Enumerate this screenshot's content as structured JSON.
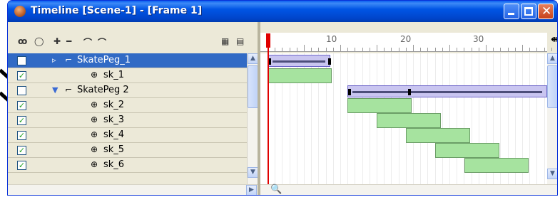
{
  "window": {
    "title": "Timeline [Scene-1] - [Frame 1]",
    "icon": "flash-icon",
    "controls": [
      "minimize",
      "maximize",
      "close"
    ]
  },
  "toolbar": {
    "icons": [
      "onion-skin-icon",
      "outline-icon",
      "add-layer-icon",
      "remove-layer-icon",
      "add-guide-icon",
      "add-folder-icon",
      "bone-settings-icon",
      "layer-properties-icon"
    ]
  },
  "layers": [
    {
      "label": "SkatePeg_1",
      "checked": false,
      "selected": true,
      "type": "group",
      "expanded": false
    },
    {
      "label": "sk_1",
      "checked": true,
      "selected": false,
      "type": "bone",
      "expanded": false
    },
    {
      "label": "SkatePeg 2",
      "checked": false,
      "selected": false,
      "type": "group",
      "expanded": true
    },
    {
      "label": "sk_2",
      "checked": true,
      "selected": false,
      "type": "bone",
      "expanded": false
    },
    {
      "label": "sk_3",
      "checked": true,
      "selected": false,
      "type": "bone",
      "expanded": false
    },
    {
      "label": "sk_4",
      "checked": true,
      "selected": false,
      "type": "bone",
      "expanded": false
    },
    {
      "label": "sk_5",
      "checked": true,
      "selected": false,
      "type": "bone",
      "expanded": false
    },
    {
      "label": "sk_6",
      "checked": true,
      "selected": false,
      "type": "bone",
      "expanded": false
    }
  ],
  "ruler": {
    "labels": [
      "10",
      "20",
      "30"
    ]
  },
  "colors": {
    "title_bar": "#0055e5",
    "selection": "#316ac5",
    "playhead": "#e00000",
    "keyframe_span": "#a6e39f",
    "group_span": "#c9c5f0"
  }
}
